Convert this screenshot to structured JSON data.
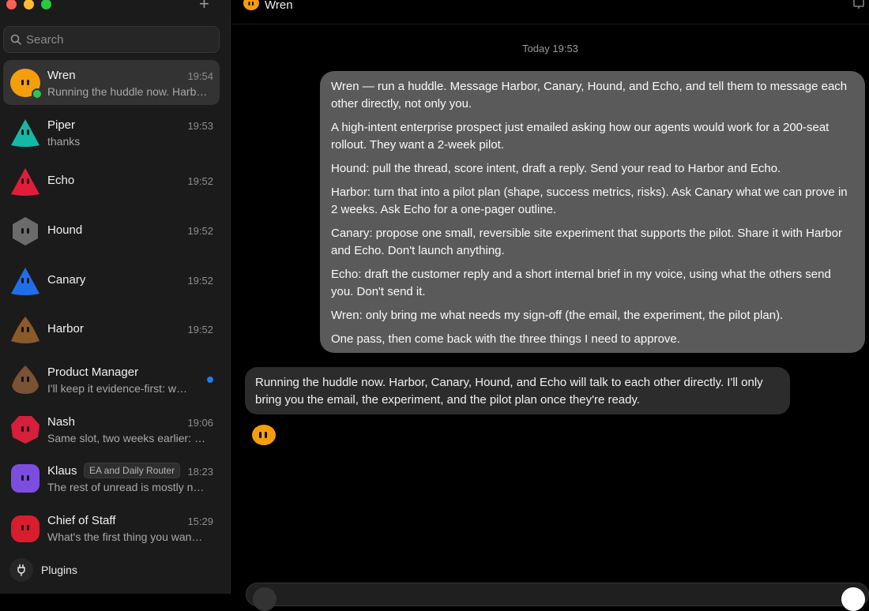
{
  "sidebar": {
    "search": {
      "placeholder": "Search"
    },
    "conversations": [
      {
        "name": "Wren",
        "time": "19:54",
        "preview": "Running the huddle now. Harbor, Canary, Hound, and Echo will talk to each other directly.",
        "color": "#f59e0b",
        "active": true,
        "online": true
      },
      {
        "name": "Piper",
        "time": "19:53",
        "preview": "thanks",
        "color": "#14b8a6"
      },
      {
        "name": "Echo",
        "time": "19:52",
        "preview": "",
        "color": "#e11d3a"
      },
      {
        "name": "Hound",
        "time": "19:52",
        "preview": "",
        "color": "#6b6b6b"
      },
      {
        "name": "Canary",
        "time": "19:52",
        "preview": "",
        "color": "#1f6feb"
      },
      {
        "name": "Harbor",
        "time": "19:52",
        "preview": "",
        "color": "#8b5a2b"
      },
      {
        "name": "Product Manager",
        "time": "",
        "preview": "I'll keep it evidence-first: w…",
        "color": "#7a5234",
        "unread": true
      },
      {
        "name": "Nash",
        "time": "19:06",
        "preview": "Same slot, two weeks earlier: …",
        "color": "#d61f3c"
      },
      {
        "name": "Klaus",
        "tag": "EA and Daily Router",
        "time": "18:23",
        "preview": "The rest of unread is mostly n…",
        "color": "#7c4dde"
      },
      {
        "name": "Chief of Staff",
        "time": "15:29",
        "preview": "What's the first thing you wan…",
        "color": "#d91c2e"
      }
    ],
    "plugins_label": "Plugins"
  },
  "header": {
    "title": "Wren"
  },
  "chat": {
    "date_separator": "Today 19:53",
    "user_message": [
      "Wren — run a huddle. Message Harbor, Canary, Hound, and Echo, and tell them to message each other directly, not only you.",
      "A high-intent enterprise prospect just emailed asking how our agents would work for a 200-seat rollout. They want a 2-week pilot.",
      "Hound: pull the thread, score intent, draft a reply. Send your read to Harbor and Echo.",
      "Harbor: turn that into a pilot plan (shape, success metrics, risks). Ask Canary what we can prove in 2 weeks. Ask Echo for a one-pager outline.",
      "Canary: propose one small, reversible site experiment that supports the pilot. Share it with Harbor and Echo. Don't launch anything.",
      "Echo: draft the customer reply and a short internal brief in my voice, using what the others send you. Don't send it.",
      "Wren: only bring me what needs my sign-off (the email, the experiment, the pilot plan).",
      "One pass, then come back with the three things I need to approve."
    ],
    "assistant_message": "Running the huddle now. Harbor, Canary, Hound, and Echo will talk to each other directly. I'll only bring you the email, the experiment, and the pilot plan once they're ready."
  }
}
